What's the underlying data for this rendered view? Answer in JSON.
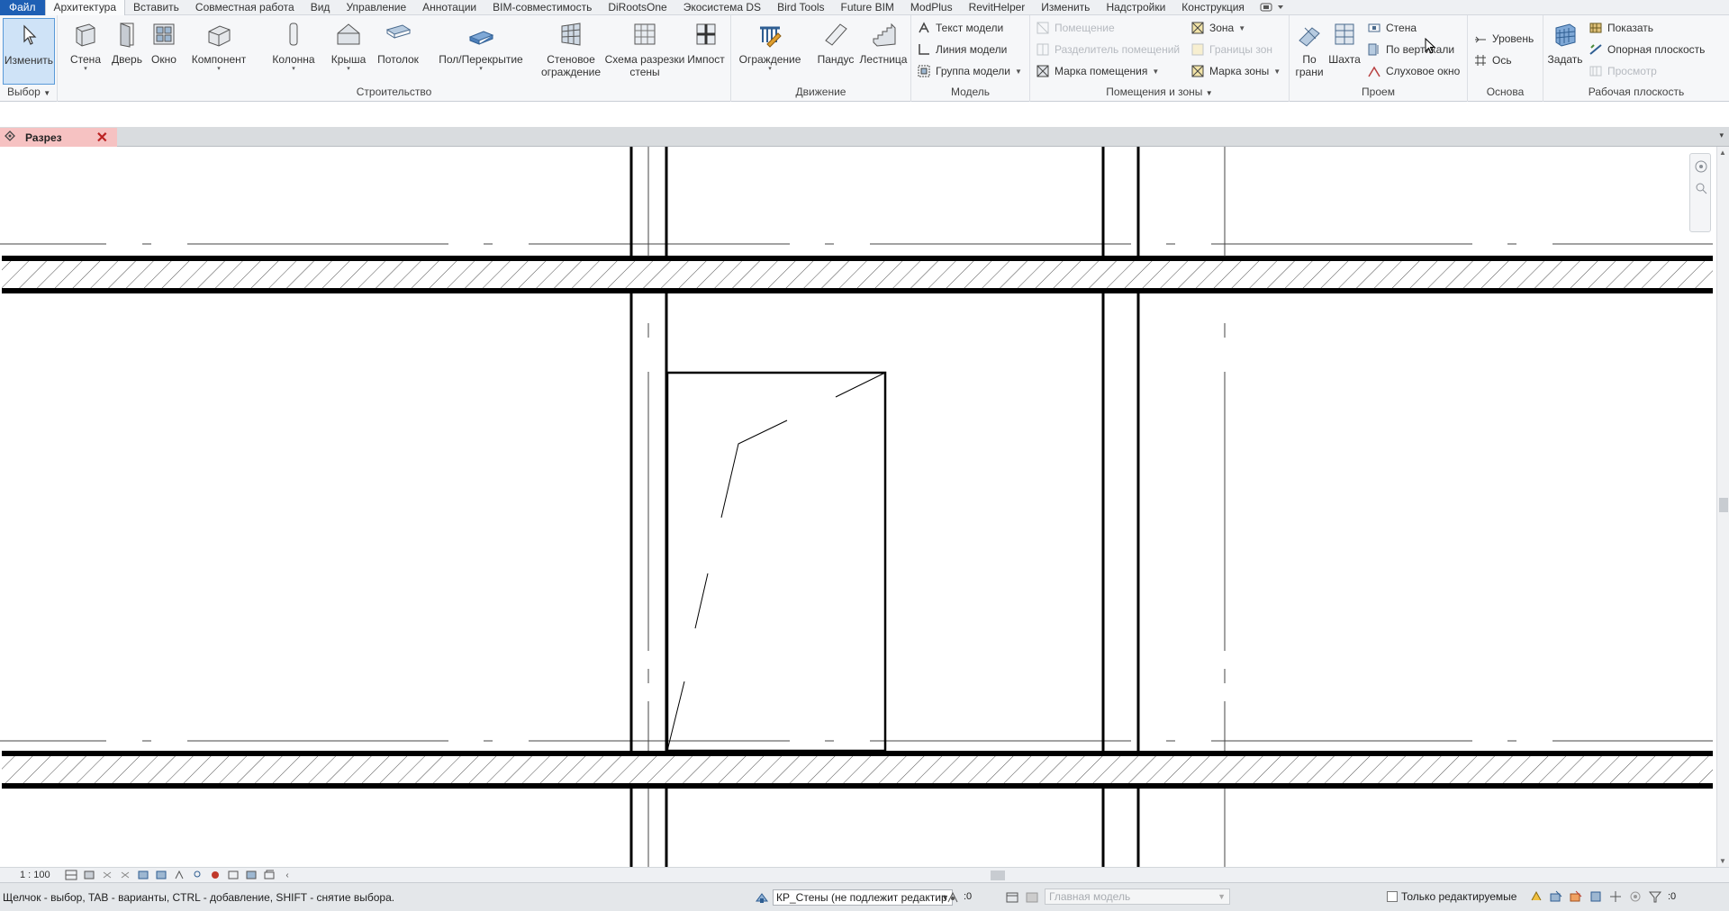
{
  "menu": {
    "tabs": [
      "Файл",
      "Архитектура",
      "Вставить",
      "Совместная работа",
      "Вид",
      "Управление",
      "Аннотации",
      "BIM-совместимость",
      "DiRootsOne",
      "Экосистема DS",
      "Bird Tools",
      "Future BIM",
      "ModPlus",
      "RevitHelper",
      "Изменить",
      "Надстройки",
      "Конструкция"
    ],
    "active_tab": "Архитектура"
  },
  "ribbon": {
    "select": {
      "modify": "Изменить",
      "label": "Выбор"
    },
    "build": {
      "label": "Строительство",
      "wall": "Стена",
      "door": "Дверь",
      "window": "Окно",
      "component": "Компонент",
      "column": "Колонна",
      "roof": "Крыша",
      "ceiling": "Потолок",
      "floor": "Пол/Перекрытие",
      "curtain_system": "Стеновое\nограждение",
      "curtain_grid": "Схема разрезки\nстены",
      "mullion": "Импост"
    },
    "circulation": {
      "label": "Движение",
      "railing": "Ограждение",
      "ramp": "Пандус",
      "stair": "Лестница"
    },
    "model": {
      "label": "Модель",
      "model_text": "Текст модели",
      "model_line": "Линия модели",
      "model_group": "Группа модели"
    },
    "rooms": {
      "label": "Помещения и зоны",
      "room": "Помещение",
      "room_separator": "Разделитель помещений",
      "room_tag": "Марка помещения",
      "area": "Зона",
      "area_boundary": "Границы зон",
      "area_tag": "Марка зоны"
    },
    "opening": {
      "label": "Проем",
      "by_face": "По\nграни",
      "shaft": "Шахта",
      "wall": "Стена",
      "vertical": "По вертикали",
      "dormer": "Слуховое окно"
    },
    "datum": {
      "label": "Основа",
      "level": "Уровень",
      "grid": "Ось"
    },
    "workplane": {
      "label": "Рабочая плоскость",
      "set": "Задать",
      "show": "Показать",
      "ref_plane": "Опорная плоскость",
      "viewer": "Просмотр"
    }
  },
  "document": {
    "tab_title": "Разрез",
    "close": "✕"
  },
  "viewbar": {
    "scale": "1 : 100"
  },
  "status": {
    "hint": "Щелчок - выбор, TAB - варианты, CTRL - добавление, SHIFT - снятие выбора.",
    "workset": "КР_Стены (не подлежит редактир",
    "workset_count": ":0",
    "main_model": "Главная модель",
    "only_editable": "Только редактируемые",
    "filter_count": ":0"
  },
  "colors": {
    "file_tab": "#1e5fb4",
    "doc_tab": "#f6c2c2",
    "selected_tool": "#cfe3f7"
  }
}
